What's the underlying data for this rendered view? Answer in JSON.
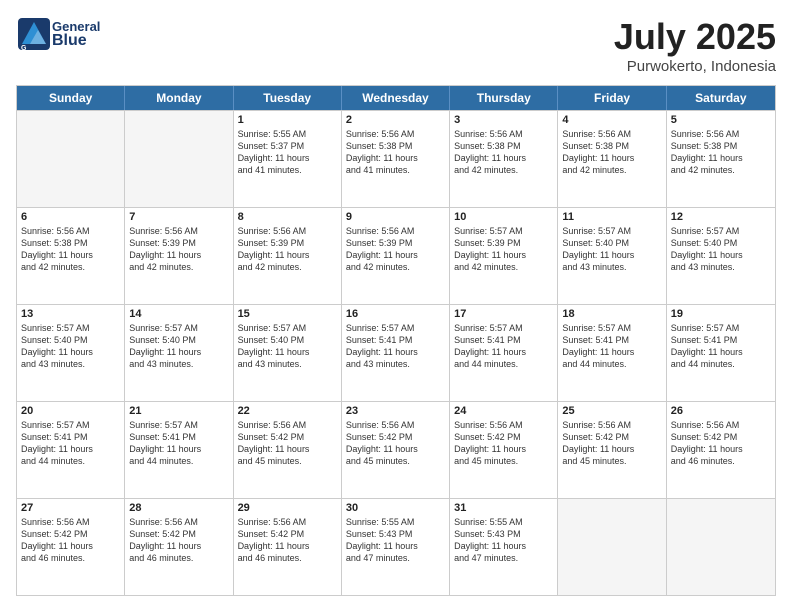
{
  "header": {
    "logo_general": "General",
    "logo_blue": "Blue",
    "month_title": "July 2025",
    "location": "Purwokerto, Indonesia"
  },
  "weekdays": [
    "Sunday",
    "Monday",
    "Tuesday",
    "Wednesday",
    "Thursday",
    "Friday",
    "Saturday"
  ],
  "rows": [
    [
      {
        "day": "",
        "info": "",
        "empty": true
      },
      {
        "day": "",
        "info": "",
        "empty": true
      },
      {
        "day": "1",
        "info": "Sunrise: 5:55 AM\nSunset: 5:37 PM\nDaylight: 11 hours\nand 41 minutes.",
        "empty": false
      },
      {
        "day": "2",
        "info": "Sunrise: 5:56 AM\nSunset: 5:38 PM\nDaylight: 11 hours\nand 41 minutes.",
        "empty": false
      },
      {
        "day": "3",
        "info": "Sunrise: 5:56 AM\nSunset: 5:38 PM\nDaylight: 11 hours\nand 42 minutes.",
        "empty": false
      },
      {
        "day": "4",
        "info": "Sunrise: 5:56 AM\nSunset: 5:38 PM\nDaylight: 11 hours\nand 42 minutes.",
        "empty": false
      },
      {
        "day": "5",
        "info": "Sunrise: 5:56 AM\nSunset: 5:38 PM\nDaylight: 11 hours\nand 42 minutes.",
        "empty": false
      }
    ],
    [
      {
        "day": "6",
        "info": "Sunrise: 5:56 AM\nSunset: 5:38 PM\nDaylight: 11 hours\nand 42 minutes.",
        "empty": false
      },
      {
        "day": "7",
        "info": "Sunrise: 5:56 AM\nSunset: 5:39 PM\nDaylight: 11 hours\nand 42 minutes.",
        "empty": false
      },
      {
        "day": "8",
        "info": "Sunrise: 5:56 AM\nSunset: 5:39 PM\nDaylight: 11 hours\nand 42 minutes.",
        "empty": false
      },
      {
        "day": "9",
        "info": "Sunrise: 5:56 AM\nSunset: 5:39 PM\nDaylight: 11 hours\nand 42 minutes.",
        "empty": false
      },
      {
        "day": "10",
        "info": "Sunrise: 5:57 AM\nSunset: 5:39 PM\nDaylight: 11 hours\nand 42 minutes.",
        "empty": false
      },
      {
        "day": "11",
        "info": "Sunrise: 5:57 AM\nSunset: 5:40 PM\nDaylight: 11 hours\nand 43 minutes.",
        "empty": false
      },
      {
        "day": "12",
        "info": "Sunrise: 5:57 AM\nSunset: 5:40 PM\nDaylight: 11 hours\nand 43 minutes.",
        "empty": false
      }
    ],
    [
      {
        "day": "13",
        "info": "Sunrise: 5:57 AM\nSunset: 5:40 PM\nDaylight: 11 hours\nand 43 minutes.",
        "empty": false
      },
      {
        "day": "14",
        "info": "Sunrise: 5:57 AM\nSunset: 5:40 PM\nDaylight: 11 hours\nand 43 minutes.",
        "empty": false
      },
      {
        "day": "15",
        "info": "Sunrise: 5:57 AM\nSunset: 5:40 PM\nDaylight: 11 hours\nand 43 minutes.",
        "empty": false
      },
      {
        "day": "16",
        "info": "Sunrise: 5:57 AM\nSunset: 5:41 PM\nDaylight: 11 hours\nand 43 minutes.",
        "empty": false
      },
      {
        "day": "17",
        "info": "Sunrise: 5:57 AM\nSunset: 5:41 PM\nDaylight: 11 hours\nand 44 minutes.",
        "empty": false
      },
      {
        "day": "18",
        "info": "Sunrise: 5:57 AM\nSunset: 5:41 PM\nDaylight: 11 hours\nand 44 minutes.",
        "empty": false
      },
      {
        "day": "19",
        "info": "Sunrise: 5:57 AM\nSunset: 5:41 PM\nDaylight: 11 hours\nand 44 minutes.",
        "empty": false
      }
    ],
    [
      {
        "day": "20",
        "info": "Sunrise: 5:57 AM\nSunset: 5:41 PM\nDaylight: 11 hours\nand 44 minutes.",
        "empty": false
      },
      {
        "day": "21",
        "info": "Sunrise: 5:57 AM\nSunset: 5:41 PM\nDaylight: 11 hours\nand 44 minutes.",
        "empty": false
      },
      {
        "day": "22",
        "info": "Sunrise: 5:56 AM\nSunset: 5:42 PM\nDaylight: 11 hours\nand 45 minutes.",
        "empty": false
      },
      {
        "day": "23",
        "info": "Sunrise: 5:56 AM\nSunset: 5:42 PM\nDaylight: 11 hours\nand 45 minutes.",
        "empty": false
      },
      {
        "day": "24",
        "info": "Sunrise: 5:56 AM\nSunset: 5:42 PM\nDaylight: 11 hours\nand 45 minutes.",
        "empty": false
      },
      {
        "day": "25",
        "info": "Sunrise: 5:56 AM\nSunset: 5:42 PM\nDaylight: 11 hours\nand 45 minutes.",
        "empty": false
      },
      {
        "day": "26",
        "info": "Sunrise: 5:56 AM\nSunset: 5:42 PM\nDaylight: 11 hours\nand 46 minutes.",
        "empty": false
      }
    ],
    [
      {
        "day": "27",
        "info": "Sunrise: 5:56 AM\nSunset: 5:42 PM\nDaylight: 11 hours\nand 46 minutes.",
        "empty": false
      },
      {
        "day": "28",
        "info": "Sunrise: 5:56 AM\nSunset: 5:42 PM\nDaylight: 11 hours\nand 46 minutes.",
        "empty": false
      },
      {
        "day": "29",
        "info": "Sunrise: 5:56 AM\nSunset: 5:42 PM\nDaylight: 11 hours\nand 46 minutes.",
        "empty": false
      },
      {
        "day": "30",
        "info": "Sunrise: 5:55 AM\nSunset: 5:43 PM\nDaylight: 11 hours\nand 47 minutes.",
        "empty": false
      },
      {
        "day": "31",
        "info": "Sunrise: 5:55 AM\nSunset: 5:43 PM\nDaylight: 11 hours\nand 47 minutes.",
        "empty": false
      },
      {
        "day": "",
        "info": "",
        "empty": true
      },
      {
        "day": "",
        "info": "",
        "empty": true
      }
    ]
  ]
}
